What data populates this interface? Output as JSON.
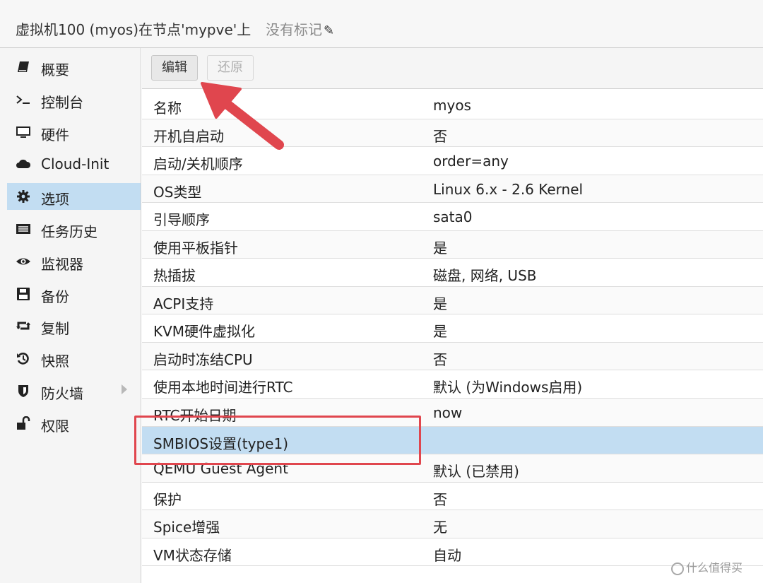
{
  "header": {
    "title": "虚拟机100 (myos)在节点'mypve'上",
    "tags_label": "没有标记"
  },
  "sidebar": {
    "items": [
      {
        "label": "概要",
        "icon": "book-icon"
      },
      {
        "label": "控制台",
        "icon": "terminal-icon"
      },
      {
        "label": "硬件",
        "icon": "monitor-icon"
      },
      {
        "label": "Cloud-Init",
        "icon": "cloud-icon"
      },
      {
        "label": "选项",
        "icon": "gear-icon",
        "active": true
      },
      {
        "label": "任务历史",
        "icon": "list-icon"
      },
      {
        "label": "监视器",
        "icon": "eye-icon"
      },
      {
        "label": "备份",
        "icon": "floppy-icon"
      },
      {
        "label": "复制",
        "icon": "retweet-icon"
      },
      {
        "label": "快照",
        "icon": "history-icon"
      },
      {
        "label": "防火墙",
        "icon": "shield-icon",
        "has_submenu": true
      },
      {
        "label": "权限",
        "icon": "unlock-icon"
      }
    ]
  },
  "toolbar": {
    "edit_label": "编辑",
    "revert_label": "还原"
  },
  "options": {
    "rows": [
      {
        "name": "名称",
        "value": "myos"
      },
      {
        "name": "开机自启动",
        "value": "否"
      },
      {
        "name": "启动/关机顺序",
        "value": "order=any"
      },
      {
        "name": "OS类型",
        "value": "Linux 6.x - 2.6 Kernel"
      },
      {
        "name": "引导顺序",
        "value": "sata0"
      },
      {
        "name": "使用平板指针",
        "value": "是"
      },
      {
        "name": "热插拔",
        "value": "磁盘, 网络, USB"
      },
      {
        "name": "ACPI支持",
        "value": "是"
      },
      {
        "name": "KVM硬件虚拟化",
        "value": "是"
      },
      {
        "name": "启动时冻结CPU",
        "value": "否"
      },
      {
        "name": "使用本地时间进行RTC",
        "value": "默认 (为Windows启用)"
      },
      {
        "name": "RTC开始日期",
        "value": "now"
      },
      {
        "name": "SMBIOS设置(type1)",
        "value": "",
        "selected": true
      },
      {
        "name": "QEMU Guest Agent",
        "value": "默认 (已禁用)"
      },
      {
        "name": "保护",
        "value": "否"
      },
      {
        "name": "Spice增强",
        "value": "无"
      },
      {
        "name": "VM状态存储",
        "value": "自动"
      }
    ]
  },
  "watermark": "什么值得买",
  "colors": {
    "selection": "#c2ddf2",
    "annotation": "#e0464e"
  }
}
